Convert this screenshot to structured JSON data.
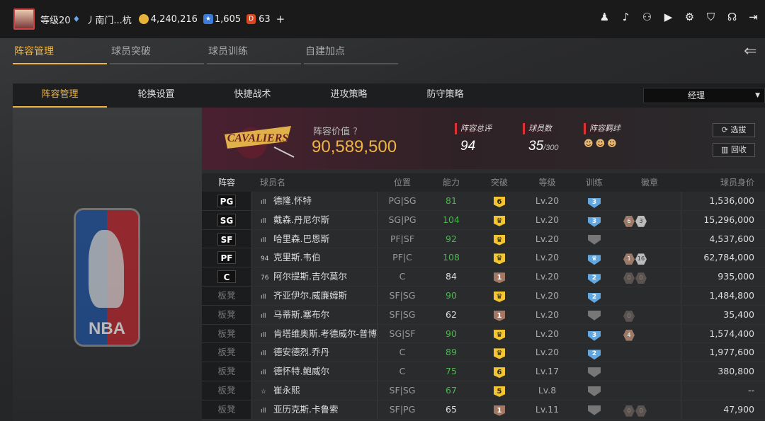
{
  "topbar": {
    "level": "等级20",
    "name": "丿南门...杭",
    "coins": "4,240,216",
    "stars": "1,605",
    "tickets": "63",
    "plus": "+"
  },
  "top_icons": [
    "user-icon",
    "bell-icon",
    "friends-icon",
    "video-icon",
    "gear-icon",
    "shield-icon",
    "headset-icon",
    "exit-icon"
  ],
  "main_tabs": [
    "阵容管理",
    "球员突破",
    "球员训练",
    "自建加点"
  ],
  "sub_tabs": [
    "阵容管理",
    "轮换设置",
    "快捷战术",
    "进攻策略",
    "防守策略"
  ],
  "dropdown": "经理",
  "team": {
    "logo_text": "CAVALIERS",
    "value_label": "阵容价值",
    "value": "90,589,500",
    "rating_label": "阵容总评",
    "rating": "94",
    "count_label": "球员数",
    "count": "35",
    "count_max": "/300",
    "bond_label": "阵容羁绊"
  },
  "buttons": {
    "pick": "选拔",
    "recycle": "回收"
  },
  "columns": [
    "阵容",
    "球员名",
    "位置",
    "能力",
    "突破",
    "等级",
    "训练",
    "徽章",
    "球员身价"
  ],
  "players": [
    {
      "slot": "PG",
      "sig": "ıll",
      "name": "德隆.怀特",
      "pos": "PG|SG",
      "ovr": "81",
      "green": true,
      "brk": "6",
      "brkc": "gold",
      "lv": "Lv.20",
      "tr": "3",
      "trc": "blue",
      "badges": [],
      "price": "1,536,000"
    },
    {
      "slot": "SG",
      "sig": "ıll",
      "name": "戴森.丹尼尔斯",
      "pos": "SG|PG",
      "ovr": "104",
      "green": true,
      "brk": "♛",
      "brkc": "gold",
      "lv": "Lv.20",
      "tr": "3",
      "trc": "blue",
      "badges": [
        [
          "6",
          "brown"
        ],
        [
          "3",
          "silver"
        ]
      ],
      "price": "15,296,000"
    },
    {
      "slot": "SF",
      "sig": "ıll",
      "name": "哈里森.巴恩斯",
      "pos": "PF|SF",
      "ovr": "92",
      "green": true,
      "brk": "♛",
      "brkc": "gold",
      "lv": "Lv.20",
      "tr": "",
      "trc": "gray",
      "badges": [],
      "price": "4,537,600"
    },
    {
      "slot": "PF",
      "sig": "94",
      "name": "克里斯.韦伯",
      "pos": "PF|C",
      "ovr": "108",
      "green": true,
      "brk": "♛",
      "brkc": "gold",
      "lv": "Lv.20",
      "tr": "♛",
      "trc": "blue",
      "badges": [
        [
          "1",
          "brown"
        ],
        [
          "16",
          "silver"
        ]
      ],
      "price": "62,784,000"
    },
    {
      "slot": "C",
      "sig": "76",
      "name": "阿尔提斯.吉尔莫尔",
      "pos": "C",
      "ovr": "84",
      "green": false,
      "brk": "1",
      "brkc": "brown",
      "lv": "Lv.20",
      "tr": "2",
      "trc": "blue",
      "badges": [
        [
          "0",
          "dim"
        ],
        [
          "0",
          "dim"
        ]
      ],
      "price": "935,000"
    },
    {
      "slot": "板凳",
      "sig": "ıll",
      "name": "齐亚伊尔.威廉姆斯",
      "pos": "SF|SG",
      "ovr": "90",
      "green": true,
      "brk": "♛",
      "brkc": "gold",
      "lv": "Lv.20",
      "tr": "2",
      "trc": "blue",
      "badges": [],
      "price": "1,484,800"
    },
    {
      "slot": "板凳",
      "sig": "ıll",
      "name": "马蒂斯.塞布尔",
      "pos": "SF|SG",
      "ovr": "62",
      "green": false,
      "brk": "1",
      "brkc": "brown",
      "lv": "Lv.20",
      "tr": "",
      "trc": "gray",
      "badges": [
        [
          "0",
          "dim"
        ]
      ],
      "price": "35,400"
    },
    {
      "slot": "板凳",
      "sig": "ıll",
      "name": "肯塔维奥斯.考德威尔-普博",
      "pos": "SG|SF",
      "ovr": "90",
      "green": true,
      "brk": "♛",
      "brkc": "gold",
      "lv": "Lv.20",
      "tr": "3",
      "trc": "blue",
      "badges": [
        [
          "4",
          "brown"
        ]
      ],
      "price": "1,574,400"
    },
    {
      "slot": "板凳",
      "sig": "ıll",
      "name": "德安德烈.乔丹",
      "pos": "C",
      "ovr": "89",
      "green": true,
      "brk": "♛",
      "brkc": "gold",
      "lv": "Lv.20",
      "tr": "2",
      "trc": "blue",
      "badges": [],
      "price": "1,977,600"
    },
    {
      "slot": "板凳",
      "sig": "ıll",
      "name": "德怀特.鲍威尔",
      "pos": "C",
      "ovr": "75",
      "green": true,
      "brk": "6",
      "brkc": "gold",
      "lv": "Lv.17",
      "tr": "",
      "trc": "gray",
      "badges": [],
      "price": "380,800"
    },
    {
      "slot": "板凳",
      "sig": "☆",
      "name": "崔永熙",
      "pos": "SF|SG",
      "ovr": "67",
      "green": true,
      "brk": "5",
      "brkc": "gold",
      "lv": "Lv.8",
      "tr": "",
      "trc": "gray",
      "badges": [],
      "price": "--"
    },
    {
      "slot": "板凳",
      "sig": "ıll",
      "name": "亚历克斯.卡鲁索",
      "pos": "SF|PG",
      "ovr": "65",
      "green": false,
      "brk": "1",
      "brkc": "brown",
      "lv": "Lv.11",
      "tr": "",
      "trc": "gray",
      "badges": [
        [
          "0",
          "dim"
        ],
        [
          "0",
          "dim"
        ]
      ],
      "price": "47,900"
    }
  ]
}
